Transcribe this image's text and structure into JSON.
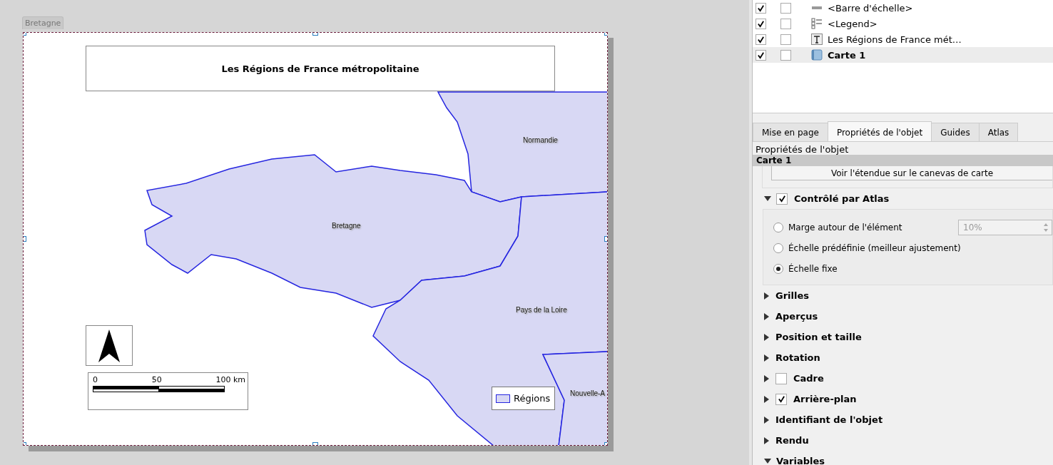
{
  "canvas": {
    "atlas_tab": "Bretagne",
    "title": "Les Régions de France métropolitaine",
    "map_labels": [
      {
        "text": "Normandie",
        "kind": "normandie"
      },
      {
        "text": "Bretagne",
        "kind": "bretagne"
      },
      {
        "text": "Pays de la Loire",
        "kind": "loire"
      },
      {
        "text": "Nouvelle-A",
        "kind": "aquitaine"
      }
    ],
    "scalebar": {
      "labels": [
        "0",
        "50",
        "100 km"
      ]
    },
    "legend": {
      "label": "Régions"
    }
  },
  "layers": [
    {
      "name": "<Barre d'échelle>",
      "kind": "scalebar",
      "visible": true,
      "locked": false,
      "selected": false
    },
    {
      "name": "<Legend>",
      "kind": "legend",
      "visible": true,
      "locked": false,
      "selected": false
    },
    {
      "name": "Les Régions de France mét…",
      "kind": "label",
      "visible": true,
      "locked": false,
      "selected": false
    },
    {
      "name": "Carte 1",
      "kind": "map",
      "visible": true,
      "locked": false,
      "selected": true
    }
  ],
  "tabs": [
    {
      "label": "Mise en page",
      "selected": false
    },
    {
      "label": "Propriétés de l'objet",
      "selected": true
    },
    {
      "label": "Guides",
      "selected": false
    },
    {
      "label": "Atlas",
      "selected": false
    }
  ],
  "panel": {
    "heading": "Propriétés de l'objet",
    "item_title": "Carte 1",
    "extent_button": "Voir l'étendue sur le canevas de carte",
    "atlas_group": {
      "label": "Contrôlé par Atlas",
      "expanded": true,
      "checked": true,
      "options": [
        {
          "label": "Marge autour de l'élément",
          "selected": false
        },
        {
          "label": "Échelle prédéfinie (meilleur ajustement)",
          "selected": false
        },
        {
          "label": "Échelle fixe",
          "selected": true
        }
      ],
      "margin_field": {
        "value": "10%",
        "disabled": true
      }
    },
    "sections": [
      {
        "label": "Grilles",
        "expanded": false
      },
      {
        "label": "Aperçus",
        "expanded": false
      },
      {
        "label": "Position et taille",
        "expanded": false
      },
      {
        "label": "Rotation",
        "expanded": false
      },
      {
        "label": "Cadre",
        "expanded": false,
        "checked": false
      },
      {
        "label": "Arrière-plan",
        "expanded": false,
        "checked": true
      },
      {
        "label": "Identifiant de l'objet",
        "expanded": false
      },
      {
        "label": "Rendu",
        "expanded": false
      },
      {
        "label": "Variables",
        "expanded": true
      }
    ]
  }
}
